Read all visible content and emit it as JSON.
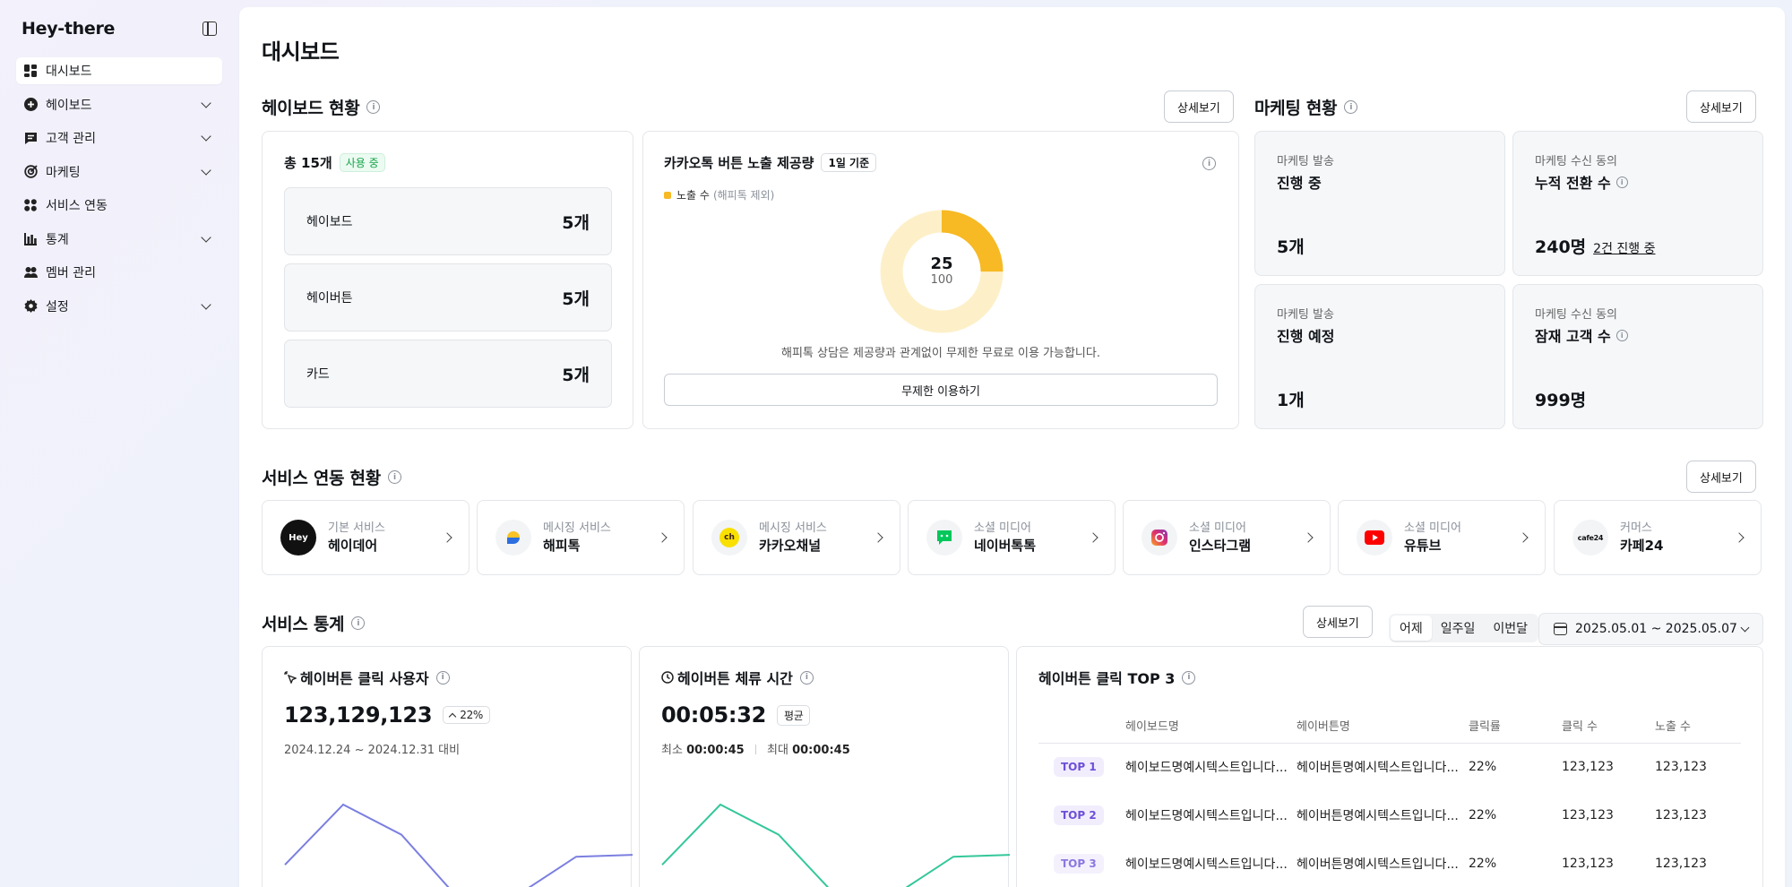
{
  "app": {
    "name": "Hey-there"
  },
  "sidebar": {
    "items": [
      {
        "label": "대시보드",
        "icon": "dashboard-icon",
        "active": true,
        "chevron": false
      },
      {
        "label": "헤이보드",
        "icon": "plus-circle-icon",
        "active": false,
        "chevron": true
      },
      {
        "label": "고객 관리",
        "icon": "chat-icon",
        "active": false,
        "chevron": true
      },
      {
        "label": "마케팅",
        "icon": "target-icon",
        "active": false,
        "chevron": true
      },
      {
        "label": "서비스 연동",
        "icon": "grid-icon",
        "active": false,
        "chevron": false
      },
      {
        "label": "통계",
        "icon": "bar-chart-icon",
        "active": false,
        "chevron": true
      },
      {
        "label": "멤버 관리",
        "icon": "users-icon",
        "active": false,
        "chevron": false
      },
      {
        "label": "설정",
        "icon": "gear-icon",
        "active": false,
        "chevron": true
      }
    ]
  },
  "page": {
    "title": "대시보드"
  },
  "heyboard_status": {
    "title": "헤이보드 현황",
    "detail_label": "상세보기",
    "total": "총 15개",
    "in_use": "사용 중",
    "rows": [
      {
        "label": "헤이보드",
        "value": "5개"
      },
      {
        "label": "헤이버튼",
        "value": "5개"
      },
      {
        "label": "카드",
        "value": "5개"
      }
    ]
  },
  "kakao": {
    "title": "카카오톡 버튼 노출 제공량",
    "badge": "1일 기준",
    "legend": "노출 수",
    "legend_sub": "(해피톡 제외)",
    "used": "25",
    "total": "100",
    "used_fraction": 0.25,
    "note": "해피톡 상담은 제공량과 관계없이 무제한 무료로 이용 가능합니다.",
    "button": "무제한 이용하기",
    "color_used": "#F7B924",
    "color_rest": "#FDF0C9"
  },
  "marketing": {
    "title": "마케팅 현황",
    "detail_label": "상세보기",
    "cards": [
      {
        "caption": "마케팅 발송",
        "title": "진행 중",
        "value": "5개",
        "info": false,
        "link": ""
      },
      {
        "caption": "마케팅 수신 동의",
        "title": "누적 전환 수",
        "value": "240명",
        "info": true,
        "link": "2건 진행 중"
      },
      {
        "caption": "마케팅 발송",
        "title": "진행 예정",
        "value": "1개",
        "info": false,
        "link": ""
      },
      {
        "caption": "마케팅 수신 동의",
        "title": "잠재 고객 수",
        "value": "999명",
        "info": true,
        "link": ""
      }
    ]
  },
  "services": {
    "title": "서비스 연동 현황",
    "detail_label": "상세보기",
    "items": [
      {
        "category": "기본 서비스",
        "name": "헤이데어",
        "logo": "Hey"
      },
      {
        "category": "메시징 서비스",
        "name": "해피톡",
        "logo": ""
      },
      {
        "category": "메시징 서비스",
        "name": "카카오채널",
        "logo": "ch"
      },
      {
        "category": "소셜 미디어",
        "name": "네이버톡톡",
        "logo": ""
      },
      {
        "category": "소셜 미디어",
        "name": "인스타그램",
        "logo": ""
      },
      {
        "category": "소셜 미디어",
        "name": "유튜브",
        "logo": ""
      },
      {
        "category": "커머스",
        "name": "카페24",
        "logo": "cafe24"
      }
    ]
  },
  "stats": {
    "title": "서비스 통계",
    "detail_label": "상세보기",
    "periods": [
      "어제",
      "일주일",
      "이번달"
    ],
    "active_period": "어제",
    "date_range": "2025.05.01 ~ 2025.05.07",
    "clicks": {
      "title": "헤이버튼 클릭 사용자",
      "value": "123,129,123",
      "change": "22%",
      "compare": "2024.12.24 ~ 2024.12.31 대비",
      "line_color": "#7B7FE0",
      "series": [
        40,
        100,
        70,
        5,
        10,
        48,
        50
      ]
    },
    "dwell": {
      "title": "헤이버튼 체류 시간",
      "value": "00:05:32",
      "badge": "평균",
      "min_label": "최소",
      "min": "00:00:45",
      "max_label": "최대",
      "max": "00:00:45",
      "line_color": "#34C79A",
      "series": [
        40,
        100,
        70,
        8,
        10,
        48,
        50
      ]
    },
    "top3": {
      "title": "헤이버튼 클릭 TOP 3",
      "headers": [
        "",
        "헤이보드명",
        "헤이버튼명",
        "클릭률",
        "클릭 수",
        "노출 수"
      ],
      "rows": [
        {
          "rank": "TOP 1",
          "board": "헤이보드명예시텍스트입니다...",
          "button": "헤이버튼명예시텍스트입니다...",
          "rate": "22%",
          "clicks": "123,123",
          "views": "123,123"
        },
        {
          "rank": "TOP 2",
          "board": "헤이보드명예시텍스트입니다...",
          "button": "헤이버튼명예시텍스트입니다...",
          "rate": "22%",
          "clicks": "123,123",
          "views": "123,123"
        },
        {
          "rank": "TOP 3",
          "board": "헤이보드명예시텍스트입니다...",
          "button": "헤이버튼명예시텍스트입니다...",
          "rate": "22%",
          "clicks": "123,123",
          "views": "123,123"
        }
      ]
    }
  }
}
